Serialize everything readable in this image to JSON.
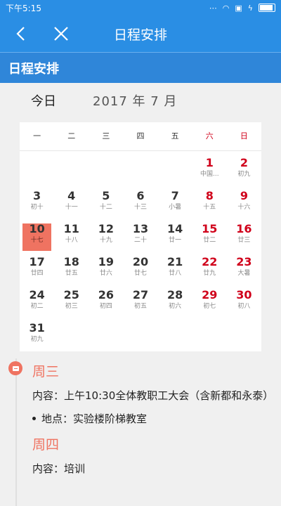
{
  "status": {
    "time": "下午5:15"
  },
  "appbar": {
    "title": "日程安排"
  },
  "section": {
    "title": "日程安排"
  },
  "calendar": {
    "today_label": "今日",
    "month_label": "2017 年 7  月",
    "weekdays": [
      "一",
      "二",
      "三",
      "四",
      "五",
      "六",
      "日"
    ],
    "rows": [
      [
        null,
        null,
        null,
        null,
        null,
        {
          "d": "1",
          "l": "中国..."
        },
        {
          "d": "2",
          "l": "初九"
        }
      ],
      [
        {
          "d": "3",
          "l": "初十"
        },
        {
          "d": "4",
          "l": "十一"
        },
        {
          "d": "5",
          "l": "十二"
        },
        {
          "d": "6",
          "l": "十三"
        },
        {
          "d": "7",
          "l": "小暑"
        },
        {
          "d": "8",
          "l": "十五"
        },
        {
          "d": "9",
          "l": "十六"
        }
      ],
      [
        {
          "d": "10",
          "l": "十七"
        },
        {
          "d": "11",
          "l": "十八"
        },
        {
          "d": "12",
          "l": "十九"
        },
        {
          "d": "13",
          "l": "二十"
        },
        {
          "d": "14",
          "l": "廿一"
        },
        {
          "d": "15",
          "l": "廿二"
        },
        {
          "d": "16",
          "l": "廿三"
        }
      ],
      [
        {
          "d": "17",
          "l": "廿四"
        },
        {
          "d": "18",
          "l": "廿五"
        },
        {
          "d": "19",
          "l": "廿六"
        },
        {
          "d": "20",
          "l": "廿七"
        },
        {
          "d": "21",
          "l": "廿八"
        },
        {
          "d": "22",
          "l": "廿九"
        },
        {
          "d": "23",
          "l": "大暑"
        }
      ],
      [
        {
          "d": "24",
          "l": "初二"
        },
        {
          "d": "25",
          "l": "初三"
        },
        {
          "d": "26",
          "l": "初四"
        },
        {
          "d": "27",
          "l": "初五"
        },
        {
          "d": "28",
          "l": "初六"
        },
        {
          "d": "29",
          "l": "初七"
        },
        {
          "d": "30",
          "l": "初八"
        }
      ],
      [
        {
          "d": "31",
          "l": "初九"
        },
        null,
        null,
        null,
        null,
        null,
        null
      ]
    ],
    "selected_day": "10",
    "colors": {
      "weekend": "#d0021b",
      "selected": "#ef7361",
      "primary": "#2a8ee4"
    }
  },
  "events": [
    {
      "day": "周三",
      "content_label": "内容：",
      "content": "上午10:30全体教职工大会（含新都和永泰）",
      "location": "地点：实验楼阶梯教室"
    },
    {
      "day": "周四",
      "content_label": "内容：",
      "content": "培训"
    }
  ]
}
